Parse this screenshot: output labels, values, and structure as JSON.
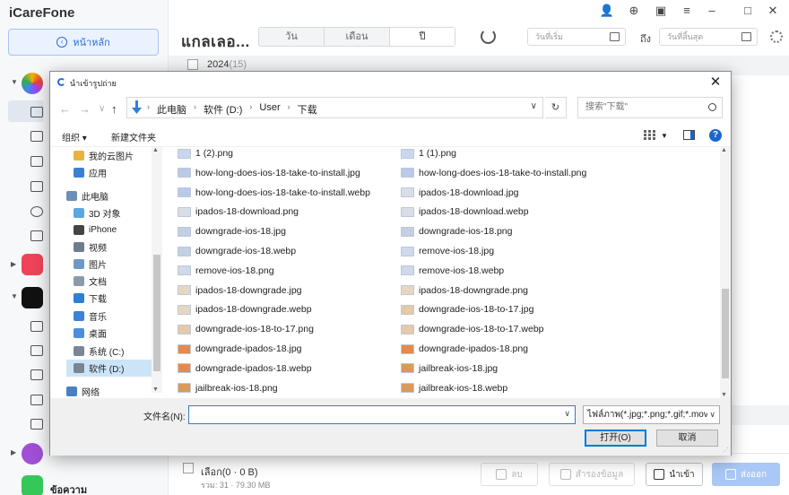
{
  "app": {
    "title": "iCareFone",
    "home_button": "หน้าหลัก",
    "page_title": "แกลเลอ...",
    "segments": [
      "วัน",
      "เดือน",
      "ปี"
    ],
    "start_date_placeholder": "วันที่เริ่ม",
    "to_label": "ถึง",
    "end_date_placeholder": "วันที่สิ้นสุด",
    "year_label": "2024",
    "year_count": "(15)",
    "sidebar_label_partial": "ข้อความ",
    "bottom": {
      "selected": "เลือก(0 · 0 B)",
      "total": "รวม: 31 · 79.30 MB",
      "delete_label": "ลบ",
      "save_label": "สำรองข้อมูล",
      "import_label": "นำเข้า",
      "export_label": "ส่งออก"
    }
  },
  "dialog": {
    "title": "นำเข้ารูปถ่าย",
    "breadcrumbs": [
      "此电脑",
      "软件 (D:)",
      "User",
      "下载"
    ],
    "search_placeholder": "搜索\"下载\"",
    "organize_label": "组织 ▾",
    "new_folder_label": "新建文件夹",
    "nav_items": [
      {
        "label": "我的云图片",
        "icon": "cloud-folder-icon",
        "color": "#e8b341"
      },
      {
        "label": "应用",
        "icon": "apps-icon",
        "color": "#3b7fd4"
      },
      {
        "label": "此电脑",
        "icon": "computer-icon",
        "color": "#6b8fb5"
      },
      {
        "label": "3D 对象",
        "icon": "3d-objects-icon",
        "color": "#5aa7e0"
      },
      {
        "label": "iPhone",
        "icon": "phone-icon",
        "color": "#444444"
      },
      {
        "label": "视频",
        "icon": "video-folder-icon",
        "color": "#6f7c8a"
      },
      {
        "label": "图片",
        "icon": "pictures-folder-icon",
        "color": "#6f98c9"
      },
      {
        "label": "文档",
        "icon": "documents-folder-icon",
        "color": "#8c9aa8"
      },
      {
        "label": "下载",
        "icon": "download-folder-icon",
        "color": "#2f7fd6"
      },
      {
        "label": "音乐",
        "icon": "music-folder-icon",
        "color": "#3b82d8"
      },
      {
        "label": "桌面",
        "icon": "desktop-folder-icon",
        "color": "#4a90d9"
      },
      {
        "label": "系统 (C:)",
        "icon": "drive-icon",
        "color": "#7a8694"
      },
      {
        "label": "软件 (D:)",
        "icon": "drive-icon",
        "color": "#7a8694"
      },
      {
        "label": "网络",
        "icon": "network-icon",
        "color": "#4a7fc0"
      }
    ],
    "files_left": [
      {
        "name": "1 (2).png",
        "color": "#c9d7ee"
      },
      {
        "name": "how-long-does-ios-18-take-to-install.jpg",
        "color": "#b9cbe8"
      },
      {
        "name": "how-long-does-ios-18-take-to-install.webp",
        "color": "#b9cbe8"
      },
      {
        "name": "ipados-18-download.png",
        "color": "#d8dde6"
      },
      {
        "name": "downgrade-ios-18.jpg",
        "color": "#c3cfe4"
      },
      {
        "name": "downgrade-ios-18.webp",
        "color": "#c3cfe4"
      },
      {
        "name": "remove-ios-18.png",
        "color": "#cfd9ea"
      },
      {
        "name": "ipados-18-downgrade.jpg",
        "color": "#e5d7c2"
      },
      {
        "name": "ipados-18-downgrade.webp",
        "color": "#e5d7c2"
      },
      {
        "name": "downgrade-ios-18-to-17.png",
        "color": "#e6c9a8"
      },
      {
        "name": "downgrade-ipados-18.jpg",
        "color": "#e48a4e"
      },
      {
        "name": "downgrade-ipados-18.webp",
        "color": "#e48a4e"
      },
      {
        "name": "jailbreak-ios-18.png",
        "color": "#d99a5c"
      }
    ],
    "files_right": [
      {
        "name": "1 (1).png",
        "color": "#c9d7ee"
      },
      {
        "name": "how-long-does-ios-18-take-to-install.png",
        "color": "#b9cbe8"
      },
      {
        "name": "ipados-18-download.jpg",
        "color": "#d8dde6"
      },
      {
        "name": "ipados-18-download.webp",
        "color": "#d8dde6"
      },
      {
        "name": "downgrade-ios-18.png",
        "color": "#c3cfe4"
      },
      {
        "name": "remove-ios-18.jpg",
        "color": "#cfd9ea"
      },
      {
        "name": "remove-ios-18.webp",
        "color": "#cfd9ea"
      },
      {
        "name": "ipados-18-downgrade.png",
        "color": "#e5d7c2"
      },
      {
        "name": "downgrade-ios-18-to-17.jpg",
        "color": "#e6c9a8"
      },
      {
        "name": "downgrade-ios-18-to-17.webp",
        "color": "#e6c9a8"
      },
      {
        "name": "downgrade-ipados-18.png",
        "color": "#e48a4e"
      },
      {
        "name": "jailbreak-ios-18.jpg",
        "color": "#d99a5c"
      },
      {
        "name": "jailbreak-ios-18.webp",
        "color": "#d99a5c"
      }
    ],
    "filename_label": "文件名(N):",
    "filename_value": "",
    "filetype_value": "ไฟล์ภาพ(*.jpg;*.png;*.gif;*.mov",
    "open_label": "打开(O)",
    "cancel_label": "取消"
  },
  "colors": {
    "accent": "#2f6bd6",
    "selection": "#cce4f7",
    "primary_disabled": "#a9c8f5"
  }
}
